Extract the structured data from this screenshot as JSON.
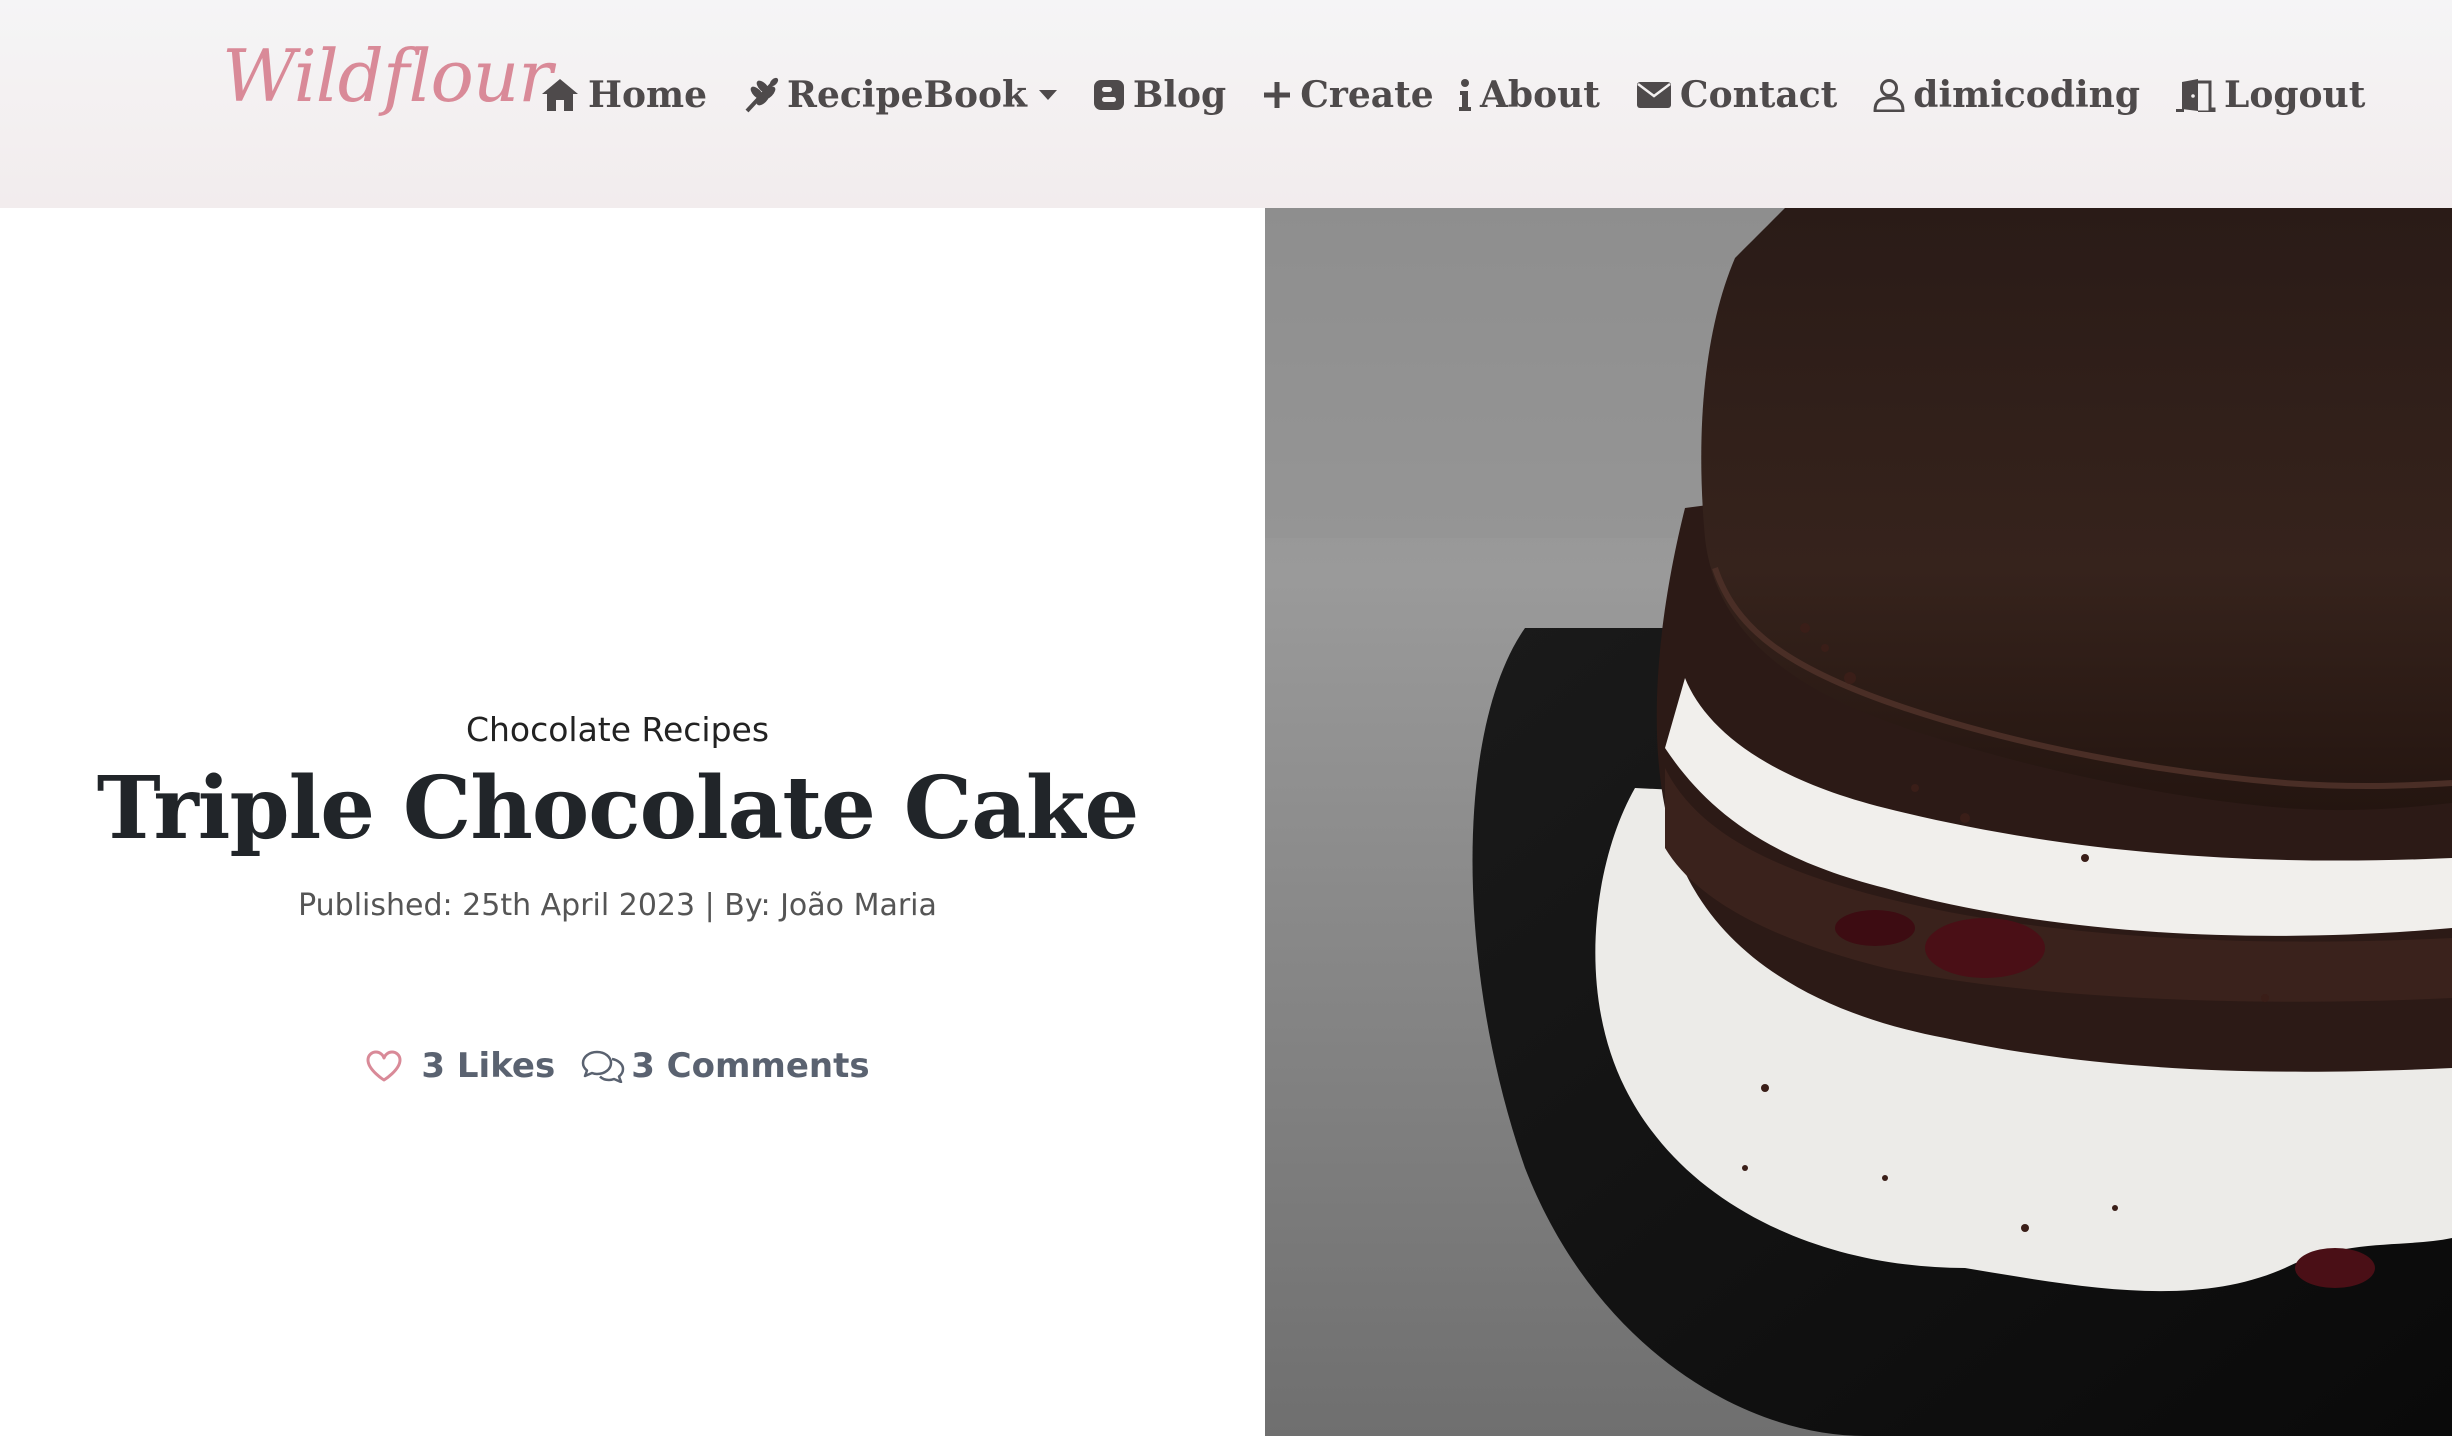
{
  "brand": {
    "name": "Wildflour"
  },
  "nav": {
    "left": [
      {
        "label": "Home",
        "icon": "home-icon"
      },
      {
        "label": "RecipeBook",
        "icon": "wheat-icon",
        "dropdown": true
      },
      {
        "label": "Blog",
        "icon": "blogger-icon"
      },
      {
        "label": "Create",
        "icon": "plus-icon"
      }
    ],
    "right": [
      {
        "label": "About",
        "icon": "info-icon"
      },
      {
        "label": "Contact",
        "icon": "envelope-icon"
      },
      {
        "label": "dimicoding",
        "icon": "user-icon"
      },
      {
        "label": "Logout",
        "icon": "door-icon"
      }
    ]
  },
  "post": {
    "category": "Chocolate Recipes",
    "title": "Triple Chocolate Cake",
    "meta": "Published: 25th April 2023 | By: João Maria",
    "likes": "3 Likes",
    "comments": "3 Comments"
  },
  "colors": {
    "brand": "#d98a98",
    "nav_text": "#4e4a4b",
    "title": "#212529",
    "heart": "#d98a98",
    "stats": "#5a6270"
  }
}
